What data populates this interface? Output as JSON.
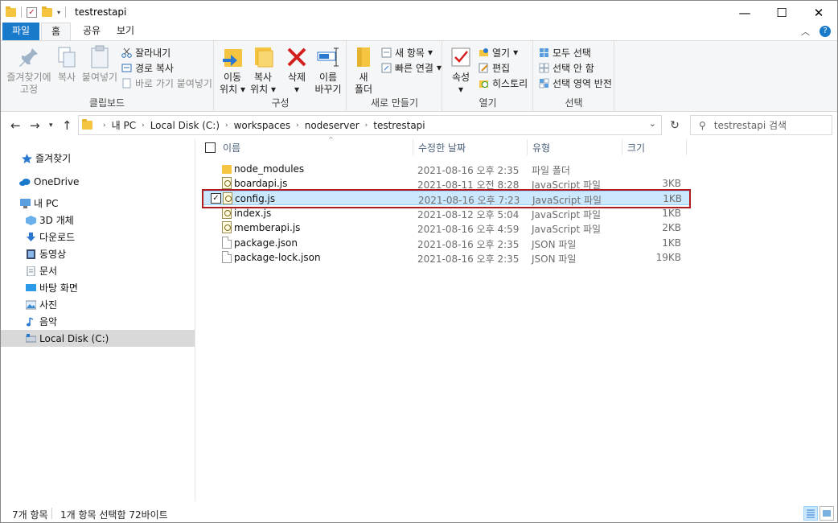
{
  "window": {
    "title": "testrestapi",
    "controls": {
      "minimize": "—",
      "maximize": "☐",
      "close": "✕"
    }
  },
  "ribbon_tabs": {
    "file": "파일",
    "home": "홈",
    "share": "공유",
    "view": "보기"
  },
  "ribbon": {
    "clipboard": {
      "label": "클립보드",
      "pin": "즐겨찾기에\n고정",
      "pin_l1": "즐겨찾기에",
      "pin_l2": "고정",
      "copy": "복사",
      "paste": "붙여넣기",
      "cut": "잘라내기",
      "copy_path": "경로 복사",
      "paste_shortcut": "바로 가기 붙여넣기"
    },
    "organize": {
      "label": "구성",
      "move_l1": "이동",
      "move_l2": "위치",
      "copyto_l1": "복사",
      "copyto_l2": "위치",
      "delete": "삭제",
      "rename_l1": "이름",
      "rename_l2": "바꾸기"
    },
    "new": {
      "label": "새로 만들기",
      "folder_l1": "새",
      "folder_l2": "폴더",
      "new_item": "새 항목",
      "easy_access": "빠른 연결"
    },
    "open": {
      "label": "열기",
      "properties": "속성",
      "open": "열기",
      "edit": "편집",
      "history": "히스토리"
    },
    "select": {
      "label": "선택",
      "select_all": "모두 선택",
      "select_none": "선택 안 함",
      "invert": "선택 영역 반전"
    }
  },
  "address": {
    "crumbs": [
      "내 PC",
      "Local Disk (C:)",
      "workspaces",
      "nodeserver",
      "testrestapi"
    ],
    "search_placeholder": "testrestapi 검색"
  },
  "sidebar": {
    "items": [
      {
        "label": "즐겨찾기",
        "icon": "star-icon"
      },
      {
        "label": "OneDrive",
        "icon": "cloud-icon"
      },
      {
        "label": "내 PC",
        "icon": "computer-icon"
      },
      {
        "label": "3D 개체",
        "icon": "cube-icon"
      },
      {
        "label": "다운로드",
        "icon": "download-icon"
      },
      {
        "label": "동영상",
        "icon": "video-icon"
      },
      {
        "label": "문서",
        "icon": "document-icon"
      },
      {
        "label": "바탕 화면",
        "icon": "desktop-icon"
      },
      {
        "label": "사진",
        "icon": "picture-icon"
      },
      {
        "label": "음악",
        "icon": "music-icon"
      },
      {
        "label": "Local Disk (C:)",
        "icon": "drive-icon"
      }
    ]
  },
  "columns": {
    "name": "이름",
    "modified": "수정한 날짜",
    "type": "유형",
    "size": "크기"
  },
  "files": [
    {
      "name": "node_modules",
      "modified": "2021-08-16 오후 2:35",
      "type": "파일 폴더",
      "size": "",
      "icon": "folder-icon"
    },
    {
      "name": "boardapi.js",
      "modified": "2021-08-11 오전 8:28",
      "type": "JavaScript 파일",
      "size": "3KB",
      "icon": "js-file-icon"
    },
    {
      "name": "config.js",
      "modified": "2021-08-16 오후 7:23",
      "type": "JavaScript 파일",
      "size": "1KB",
      "icon": "js-file-icon",
      "selected": true
    },
    {
      "name": "index.js",
      "modified": "2021-08-12 오후 5:04",
      "type": "JavaScript 파일",
      "size": "1KB",
      "icon": "js-file-icon"
    },
    {
      "name": "memberapi.js",
      "modified": "2021-08-16 오후 4:59",
      "type": "JavaScript 파일",
      "size": "2KB",
      "icon": "js-file-icon"
    },
    {
      "name": "package.json",
      "modified": "2021-08-16 오후 2:35",
      "type": "JSON 파일",
      "size": "1KB",
      "icon": "file-icon"
    },
    {
      "name": "package-lock.json",
      "modified": "2021-08-16 오후 2:35",
      "type": "JSON 파일",
      "size": "19KB",
      "icon": "file-icon"
    }
  ],
  "status": {
    "count": "7개 항목",
    "selection": "1개 항목 선택함 72바이트"
  },
  "colors": {
    "file_tab": "#1979ca",
    "selected_row": "#cce8ff",
    "highlight_annotation": "#b01b22"
  }
}
